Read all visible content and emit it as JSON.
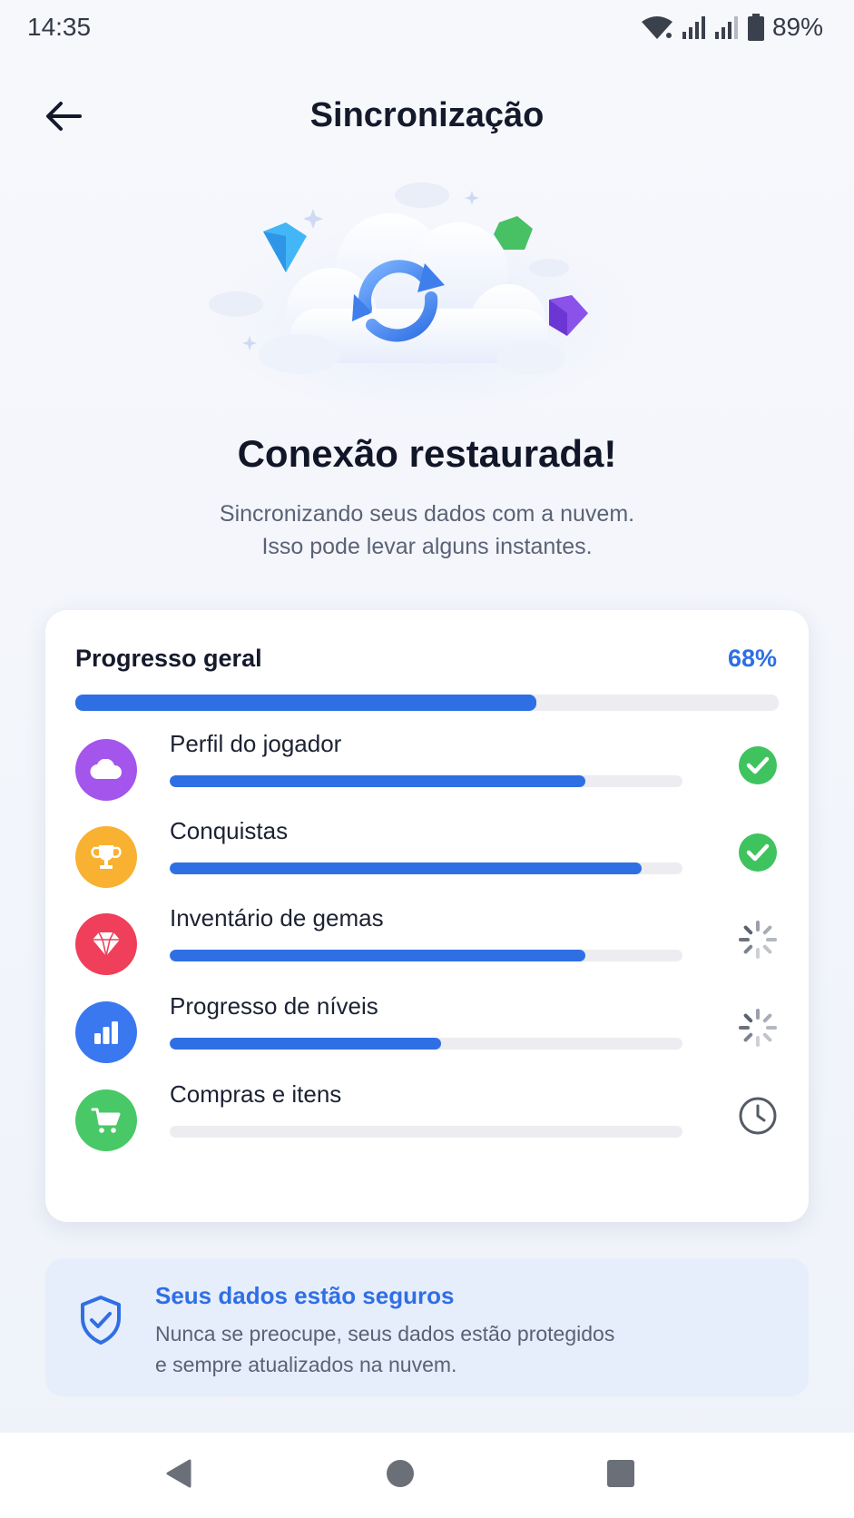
{
  "status_bar": {
    "time": "14:35",
    "battery": "89%",
    "icons": [
      "wifi-icon",
      "signal-icon",
      "signal-icon",
      "battery-icon"
    ]
  },
  "header": {
    "title": "Sincronização",
    "back_icon": "arrow-left-icon"
  },
  "hero": {
    "title": "Conexão restaurada!",
    "subtitle_line1": "Sincronizando seus dados com a nuvem.",
    "subtitle_line2": "Isso pode levar alguns instantes.",
    "illustration": "cloud-sync-icon"
  },
  "progress": {
    "label": "Progresso geral",
    "value_text": "68%",
    "value": 0.655,
    "items": [
      {
        "label": "Perfil do jogador",
        "progress": 0.81,
        "icon": "cloud-icon",
        "icon_color": "#a455ec",
        "status": "done"
      },
      {
        "label": "Conquistas",
        "progress": 0.92,
        "icon": "trophy-icon",
        "icon_color": "#f8b131",
        "status": "done"
      },
      {
        "label": "Inventário de gemas",
        "progress": 0.81,
        "icon": "gem-icon",
        "icon_color": "#ef3f5a",
        "status": "loading"
      },
      {
        "label": "Progresso de níveis",
        "progress": 0.53,
        "icon": "bar-chart-icon",
        "icon_color": "#3a78ef",
        "status": "loading"
      },
      {
        "label": "Compras e itens",
        "progress": 0.0,
        "icon": "cart-icon",
        "icon_color": "#49c867",
        "status": "pending"
      }
    ]
  },
  "secure": {
    "title": "Seus dados estão seguros",
    "text_line1": "Nunca se preocupe, seus dados estão protegidos",
    "text_line2": "e sempre atualizados na nuvem.",
    "icon": "shield-check-icon"
  },
  "colors": {
    "accent": "#2f6fe4",
    "success": "#3fc35f",
    "track": "#ececf1"
  }
}
